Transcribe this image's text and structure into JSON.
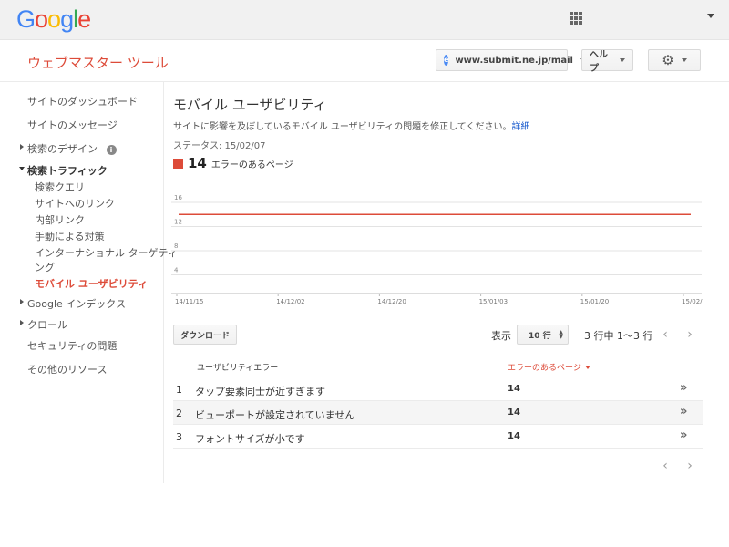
{
  "google_bar": {
    "logo": [
      "G",
      "o",
      "o",
      "g",
      "l",
      "e"
    ],
    "logo_colors": [
      "#4285f4",
      "#ea4335",
      "#fbbc05",
      "#4285f4",
      "#34a853",
      "#ea4335"
    ]
  },
  "header": {
    "app_title": "ウェブマスター ツール",
    "site": "www.submit.ne.jp/mail",
    "site_icon": "e",
    "help": "ヘルプ",
    "gear": "⚙"
  },
  "sidebar": {
    "dashboard": "サイトのダッシュボード",
    "messages": "サイトのメッセージ",
    "search_design": "検索のデザイン",
    "info_icon": "i",
    "search_traffic": "検索トラフィック",
    "sub": [
      "検索クエリ",
      "サイトへのリンク",
      "内部リンク",
      "手動による対策",
      "インターナショナル ターゲティ",
      "ング",
      "モバイル ユーザビリティ"
    ],
    "google_index": "Google インデックス",
    "crawl": "クロール",
    "security": "セキュリティの問題",
    "other": "その他のリソース"
  },
  "main": {
    "title": "モバイル ユーザビリティ",
    "description": "サイトに影響を及ぼしているモバイル ユーザビリティの問題を修正してください。",
    "details_link": "詳細",
    "status": "ステータス: 15/02/07",
    "legend_count": "14",
    "legend_label": "エラーのあるページ",
    "legend_color": "#dd4b39"
  },
  "chart_data": {
    "type": "line",
    "x": [
      "14/11/15",
      "14/12/02",
      "14/12/20",
      "15/01/03",
      "15/01/20",
      "15/02/.."
    ],
    "series": [
      {
        "name": "エラーのあるページ",
        "values": [
          14,
          14,
          14,
          14,
          14,
          14
        ]
      }
    ],
    "y_ticks": [
      "16",
      "12",
      "8",
      "4"
    ],
    "ylim": [
      0,
      16
    ],
    "grid": true,
    "color": "#dd4b39"
  },
  "controls": {
    "download": "ダウンロード",
    "show": "表示",
    "rows": "10 行",
    "pager": "3 行中 1〜3 行",
    "prev": "‹",
    "next": "›"
  },
  "table": {
    "headers": [
      "ユーザビリティエラー",
      "エラーのあるページ"
    ],
    "rows": [
      {
        "idx": "1",
        "name": "タップ要素同士が近すぎます",
        "value": "14"
      },
      {
        "idx": "2",
        "name": "ビューポートが設定されていません",
        "value": "14"
      },
      {
        "idx": "3",
        "name": "フォントサイズが小です",
        "value": "14"
      }
    ],
    "go_icon": "»"
  }
}
